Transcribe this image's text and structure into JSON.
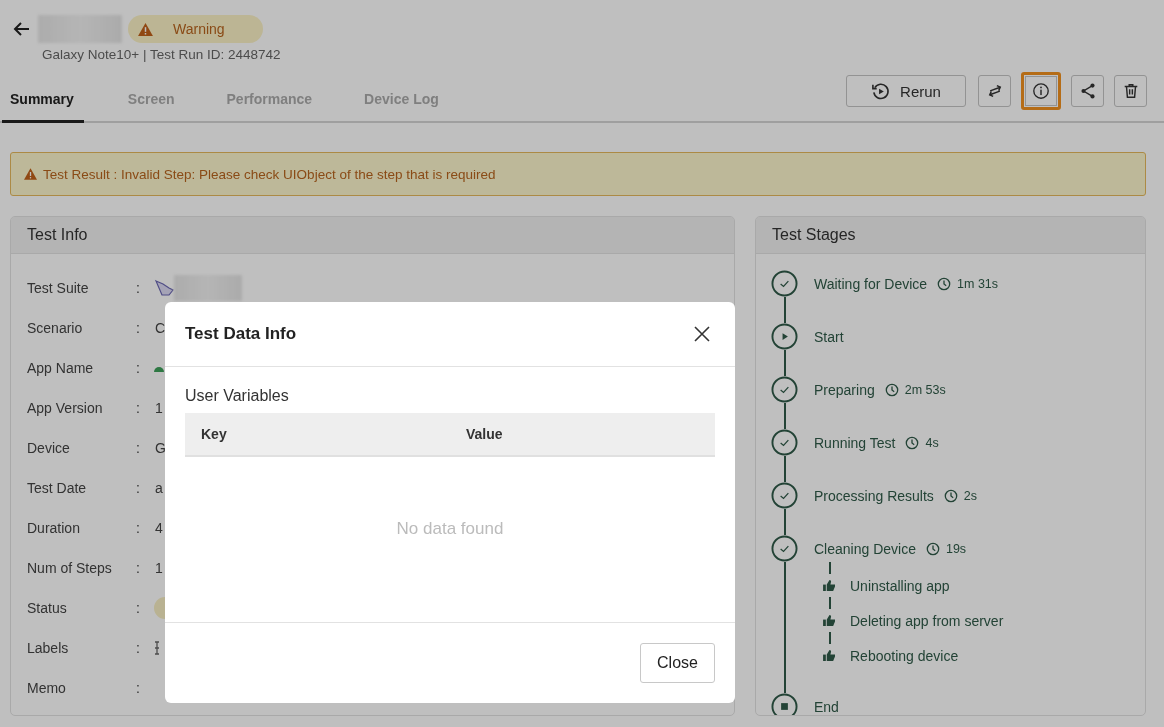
{
  "header": {
    "status_badge": "Warning",
    "subtitle": "Galaxy Note10+ | Test Run ID: 2448742"
  },
  "tabs": [
    {
      "label": "Summary",
      "selected": true
    },
    {
      "label": "Screen",
      "selected": false
    },
    {
      "label": "Performance",
      "selected": false
    },
    {
      "label": "Device Log",
      "selected": false
    }
  ],
  "toolbar": [
    {
      "kind": "rerun",
      "label": "Rerun",
      "focused": false
    },
    {
      "kind": "swap",
      "focused": false
    },
    {
      "kind": "info",
      "focused": true
    },
    {
      "kind": "share",
      "focused": false
    },
    {
      "kind": "delete",
      "focused": false
    }
  ],
  "alert": "Test Result : Invalid Step: Please check UIObject of the step that is required",
  "test_info": {
    "title": "Test Info",
    "rows": [
      {
        "label": "Test Suite",
        "separator": ":",
        "kind": "suite"
      },
      {
        "label": "Scenario",
        "separator": ":",
        "kind": "text",
        "value": "C"
      },
      {
        "label": "App Name",
        "separator": ":",
        "kind": "app"
      },
      {
        "label": "App Version",
        "separator": ":",
        "kind": "text",
        "value": "1"
      },
      {
        "label": "Device",
        "separator": ":",
        "kind": "text",
        "value": "G"
      },
      {
        "label": "Test Date",
        "separator": ":",
        "kind": "text",
        "value": "a"
      },
      {
        "label": "Duration",
        "separator": ":",
        "kind": "text",
        "value": "4"
      },
      {
        "label": "Num of Steps",
        "separator": ":",
        "kind": "text",
        "value": "1"
      },
      {
        "label": "Status",
        "separator": ":",
        "kind": "status"
      },
      {
        "label": "Labels",
        "separator": ":",
        "kind": "labels"
      },
      {
        "label": "Memo",
        "separator": ":",
        "kind": "text"
      }
    ]
  },
  "test_stages": {
    "title": "Test Stages",
    "stages": [
      {
        "kind": "done",
        "name": "Waiting for Device",
        "duration": "1m 31s"
      },
      {
        "kind": "start",
        "name": "Start"
      },
      {
        "kind": "done",
        "name": "Preparing",
        "duration": "2m 53s"
      },
      {
        "kind": "done",
        "name": "Running Test",
        "duration": "4s"
      },
      {
        "kind": "done",
        "name": "Processing Results",
        "duration": "2s"
      },
      {
        "kind": "done",
        "name": "Cleaning Device",
        "duration": "19s",
        "children": [
          {
            "name": "Uninstalling app"
          },
          {
            "name": "Deleting app from server"
          },
          {
            "name": "Rebooting device"
          }
        ]
      },
      {
        "kind": "end",
        "name": "End"
      }
    ]
  },
  "dialog": {
    "title": "Test Data Info",
    "section": "User Variables",
    "columns": [
      "Key",
      "Value"
    ],
    "empty_text": "No data found",
    "buttons": [
      "Close"
    ]
  }
}
